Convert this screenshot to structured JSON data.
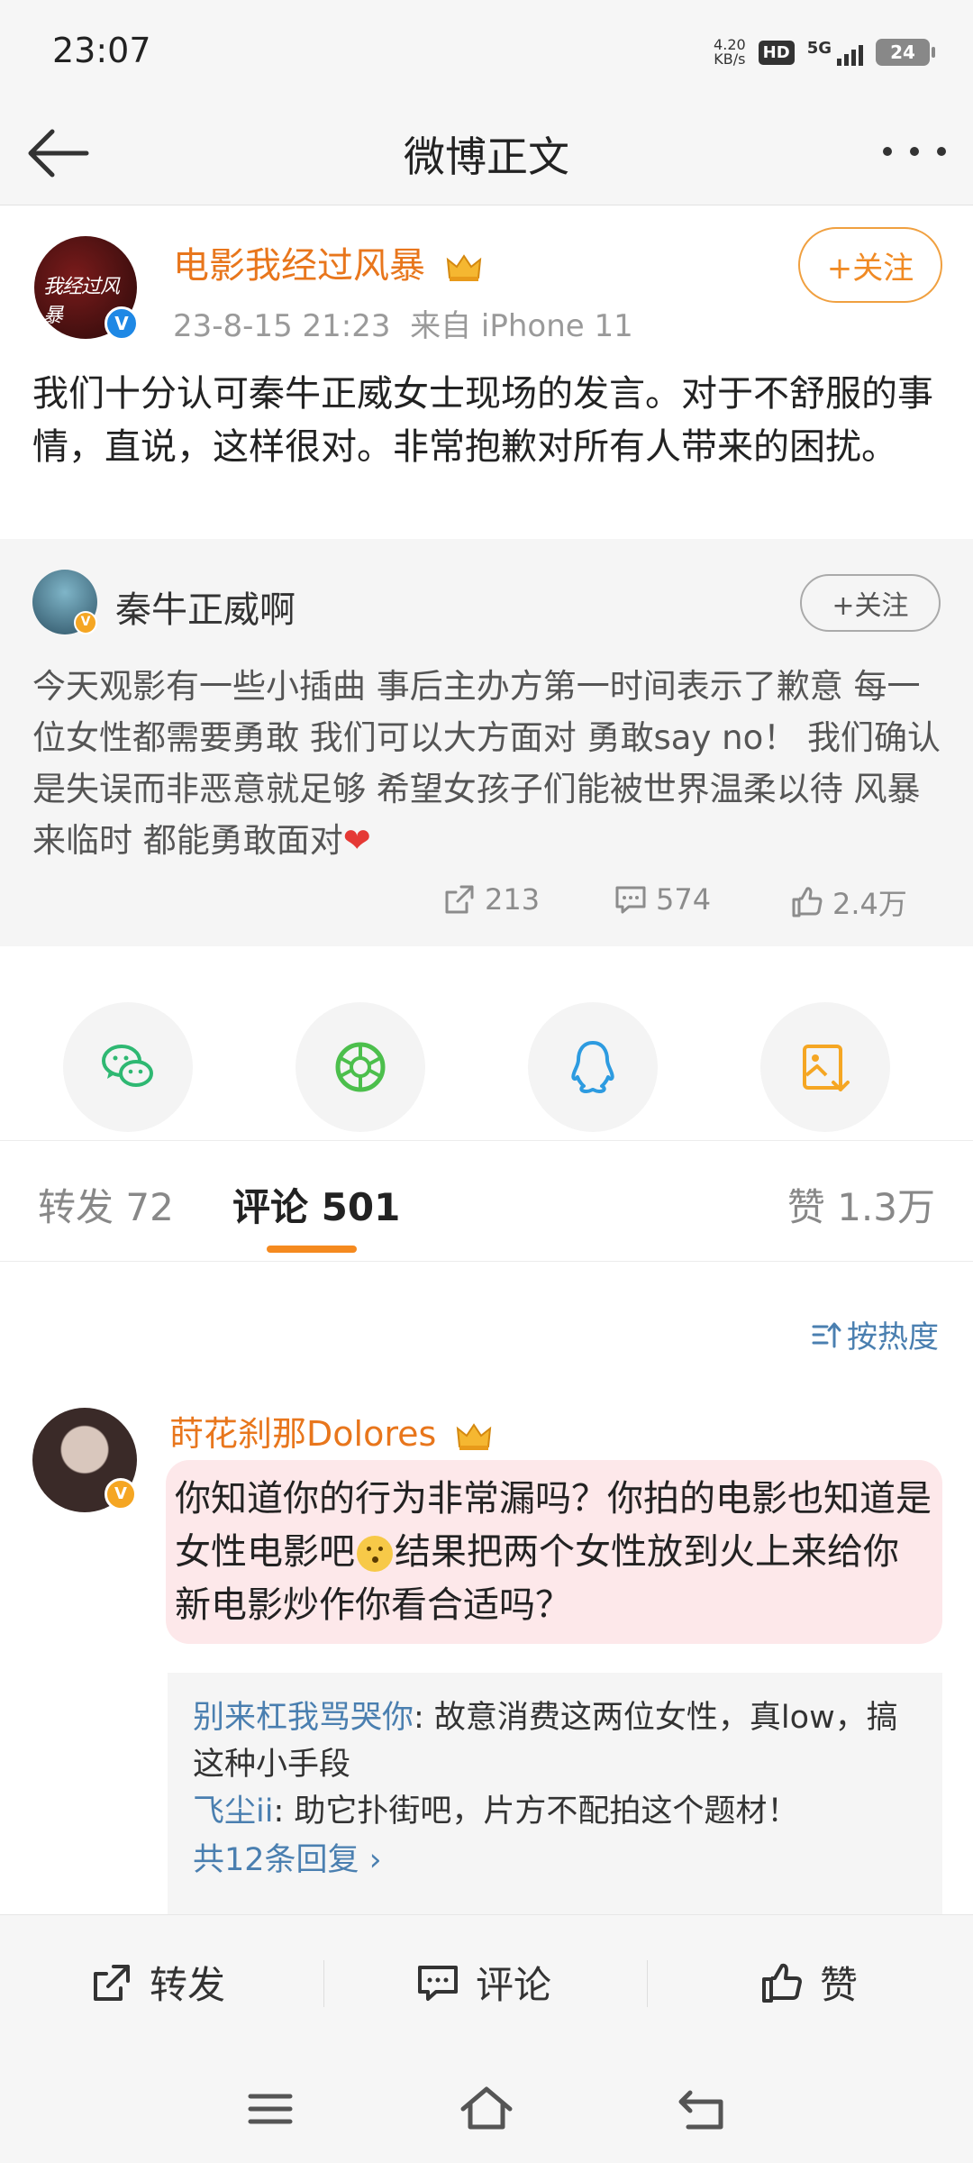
{
  "status_bar": {
    "time": "23:07",
    "net_speed_value": "4.20",
    "net_speed_unit": "KB/s",
    "hd": "HD",
    "signal_type": "5G",
    "battery": "24"
  },
  "nav": {
    "title": "微博正文"
  },
  "post": {
    "author": "电影我经过风暴",
    "avatar_text": "我经过风暴",
    "verified_badge": "V",
    "timestamp": "23-8-15 21:23",
    "source": "来自 iPhone 11",
    "follow_label": "+关注",
    "text": "我们十分认可秦牛正威女士现场的发言。对于不舒服的事情，直说，这样很对。非常抱歉对所有人带来的困扰。"
  },
  "quote": {
    "author": "秦牛正威啊",
    "follow_label": "+关注",
    "text": "今天观影有一些小插曲 事后主办方第一时间表示了歉意 每一位女性都需要勇敢 我们可以大方面对 勇敢say no！ 我们确认是失误而非恶意就足够 希望女孩子们能被世界温柔以待 风暴来临时 都能勇敢面对",
    "heart": "❤",
    "reposts": "213",
    "comments": "574",
    "likes": "2.4万"
  },
  "share": {
    "icons": [
      "wechat-icon",
      "moments-icon",
      "qq-icon",
      "save-image-icon"
    ]
  },
  "tabs": {
    "repost": "转发 72",
    "comment": "评论 501",
    "like": "赞 1.3万"
  },
  "sort": {
    "label": "按热度"
  },
  "comment": {
    "author": "莳花刹那Dolores",
    "text_before_emoji": "你知道你的行为非常漏吗？你拍的电影也知道是女性电影吧",
    "text_after_emoji": "结果把两个女性放到火上来给你新电影炒作你看合适吗？",
    "replies": [
      {
        "name": "别来杠我骂哭你",
        "text": ": 故意消费这两位女性，真low，搞这种小手段"
      },
      {
        "name": "飞尘ii",
        "text": ": 助它扑街吧，片方不配拍这个题材！"
      }
    ],
    "more_replies": "共12条回复 ›"
  },
  "action_bar": {
    "repost": "转发",
    "comment": "评论",
    "like": "赞"
  },
  "colors": {
    "accent_orange": "#e8761c",
    "link_blue": "#4a7fb0",
    "verified_blue": "#1e88e5",
    "tab_underline": "#f58a1f"
  }
}
